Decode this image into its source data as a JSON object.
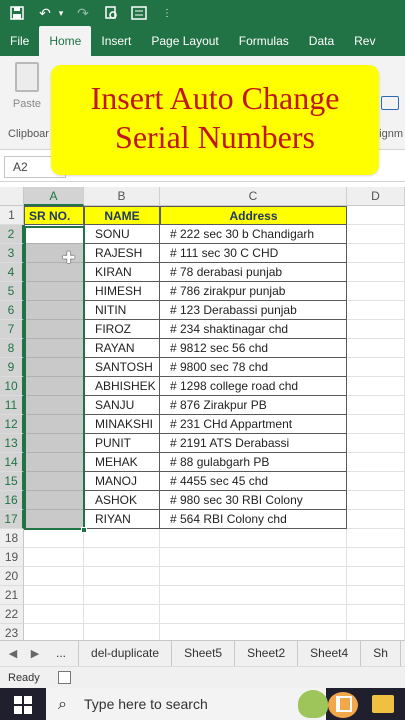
{
  "quick_access": {
    "icons": [
      "save-icon",
      "undo-icon",
      "redo-icon",
      "print-preview-icon",
      "form-icon",
      "customize-icon"
    ]
  },
  "ribbon_tabs": [
    "File",
    "Home",
    "Insert",
    "Page Layout",
    "Formulas",
    "Data",
    "Rev"
  ],
  "ribbon": {
    "paste_label": "Paste",
    "clipboard_group": "Clipboar",
    "alignment_group": "lignm"
  },
  "banner": {
    "line1": "Insert Auto Change",
    "line2": "Serial Numbers"
  },
  "formula_bar": {
    "name_box": "A2"
  },
  "columns": [
    "A",
    "B",
    "C",
    "D"
  ],
  "table": {
    "headers": [
      "SR NO.",
      "NAME",
      "Address"
    ],
    "rows": [
      {
        "num": "2",
        "name": "SONU",
        "address": "# 222 sec 30 b Chandigarh"
      },
      {
        "num": "3",
        "name": "RAJESH",
        "address": "# 111 sec 30 C CHD"
      },
      {
        "num": "4",
        "name": "KIRAN",
        "address": "# 78 derabasi punjab"
      },
      {
        "num": "5",
        "name": "HIMESH",
        "address": "# 786 zirakpur punjab"
      },
      {
        "num": "6",
        "name": "NITIN",
        "address": "# 123 Derabassi punjab"
      },
      {
        "num": "7",
        "name": "FIROZ",
        "address": "# 234 shaktinagar chd"
      },
      {
        "num": "8",
        "name": "RAYAN",
        "address": "# 9812 sec 56 chd"
      },
      {
        "num": "9",
        "name": "SANTOSH",
        "address": "# 9800 sec 78 chd"
      },
      {
        "num": "10",
        "name": "ABHISHEK",
        "address": "# 1298 college road chd"
      },
      {
        "num": "11",
        "name": "SANJU",
        "address": "# 876 Zirakpur PB"
      },
      {
        "num": "12",
        "name": "MINAKSHI",
        "address": "# 231 CHd Appartment"
      },
      {
        "num": "13",
        "name": "PUNIT",
        "address": "# 2191 ATS Derabassi"
      },
      {
        "num": "14",
        "name": "MEHAK",
        "address": "# 88 gulabgarh PB"
      },
      {
        "num": "15",
        "name": "MANOJ",
        "address": "# 4455 sec 45 chd"
      },
      {
        "num": "16",
        "name": "ASHOK",
        "address": "# 980 sec 30 RBI Colony"
      },
      {
        "num": "17",
        "name": "RIYAN",
        "address": "# 564 RBI Colony chd"
      }
    ],
    "empty_rows": [
      "18",
      "19",
      "20",
      "21",
      "22",
      "23"
    ]
  },
  "header_row_num": "1",
  "sheet_tabs": [
    "...",
    "del-duplicate",
    "Sheet5",
    "Sheet2",
    "Sheet4",
    "Sh"
  ],
  "status": {
    "ready": "Ready"
  },
  "taskbar": {
    "search_placeholder": "Type here to search"
  },
  "colors": {
    "excel_green": "#217346",
    "header_yellow": "#ffff00",
    "banner_text": "#c0151b"
  }
}
